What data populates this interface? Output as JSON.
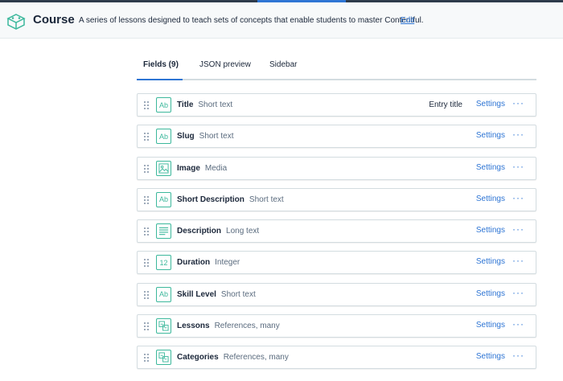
{
  "header": {
    "title": "Course",
    "description": "A series of lessons designed to teach sets of concepts that enable students to master Contentful.",
    "edit_label": "Edit",
    "icon": "content-type-icon"
  },
  "tabs": [
    {
      "label": "Fields (9)",
      "active": true
    },
    {
      "label": "JSON preview",
      "active": false
    },
    {
      "label": "Sidebar",
      "active": false
    }
  ],
  "fields": [
    {
      "name": "Title",
      "type": "Short text",
      "icon": "text-icon",
      "badge": "Entry title"
    },
    {
      "name": "Slug",
      "type": "Short text",
      "icon": "text-icon"
    },
    {
      "name": "Image",
      "type": "Media",
      "icon": "media-icon"
    },
    {
      "name": "Short Description",
      "type": "Short text",
      "icon": "text-icon"
    },
    {
      "name": "Description",
      "type": "Long text",
      "icon": "longtext-icon"
    },
    {
      "name": "Duration",
      "type": "Integer",
      "icon": "number-icon"
    },
    {
      "name": "Skill Level",
      "type": "Short text",
      "icon": "text-icon"
    },
    {
      "name": "Lessons",
      "type": "References, many",
      "icon": "reference-icon"
    },
    {
      "name": "Categories",
      "type": "References, many",
      "icon": "reference-icon"
    }
  ],
  "row_actions": {
    "settings_label": "Settings",
    "more_label": "···"
  },
  "icon_glyphs": {
    "text": "Ab",
    "number": "12"
  },
  "colors": {
    "accent": "#2e75d4",
    "field_icon": "#3cb89c",
    "text": "#1b273a",
    "muted": "#5a6b7e"
  }
}
